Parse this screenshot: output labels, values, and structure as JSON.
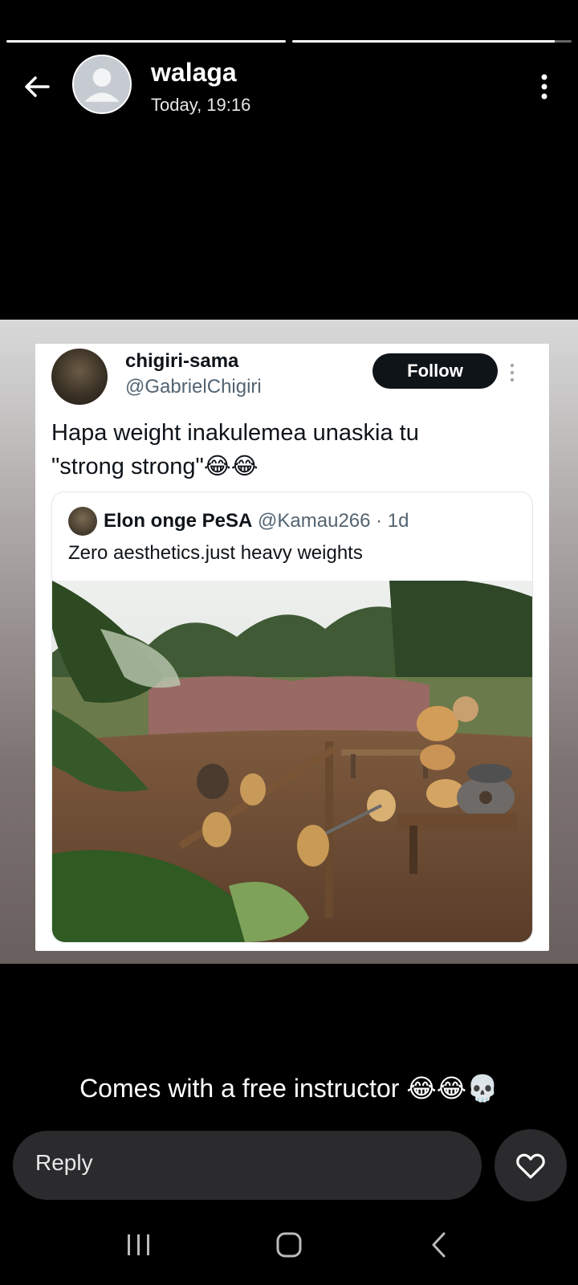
{
  "story": {
    "segments": 2,
    "author": "walaga",
    "time": "Today, 19:16",
    "caption": "Comes with a free instructor 😂😂💀"
  },
  "tweet": {
    "name": "chigiri-sama",
    "handle": "@GabrielChigiri",
    "follow_label": "Follow",
    "text_line1": "Hapa weight inakulemea unaskia tu",
    "text_line2": "\"strong strong\"😂😂",
    "quote": {
      "name": "Elon onge PeSA",
      "handle": "@Kamau266 · 1d",
      "text": "Zero aesthetics.just heavy  weights"
    }
  },
  "reply": {
    "placeholder": "Reply"
  },
  "icons": {
    "back": "back-arrow-icon",
    "menu": "more-vertical-icon",
    "like": "heart-icon",
    "nav": [
      "recent-apps-icon",
      "home-icon",
      "nav-back-icon"
    ]
  }
}
